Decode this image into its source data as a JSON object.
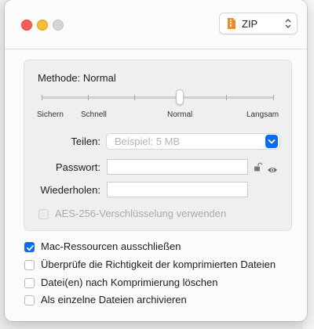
{
  "window": {
    "format_popup": {
      "value": "ZIP",
      "icon": "zip-archive-icon"
    }
  },
  "compression": {
    "method_title": "Methode: Normal",
    "speed_labels": [
      "Sichern",
      "Schnell",
      "Normal",
      "Langsam"
    ],
    "slider_level": "Normal"
  },
  "fields": {
    "split_label": "Teilen:",
    "split_placeholder": "Beispiel: 5 MB",
    "password_label": "Passwort:",
    "password_value": "",
    "repeat_label": "Wiederholen:",
    "repeat_value": "",
    "aes_label": "AES-256-Verschlüsselung verwenden",
    "aes_checked": false
  },
  "options": [
    {
      "label": "Mac-Ressourcen ausschließen",
      "checked": true
    },
    {
      "label": "Überprüfe die Richtigkeit der komprimierten Dateien",
      "checked": false
    },
    {
      "label": "Datei(en) nach Komprimierung löschen",
      "checked": false
    },
    {
      "label": "Als einzelne Dateien archivieren",
      "checked": false
    }
  ],
  "colors": {
    "accent": "#0a6cf5",
    "close": "#ff5f57",
    "minimize": "#febc2e",
    "zoom_inactive": "#d5d5d5"
  }
}
